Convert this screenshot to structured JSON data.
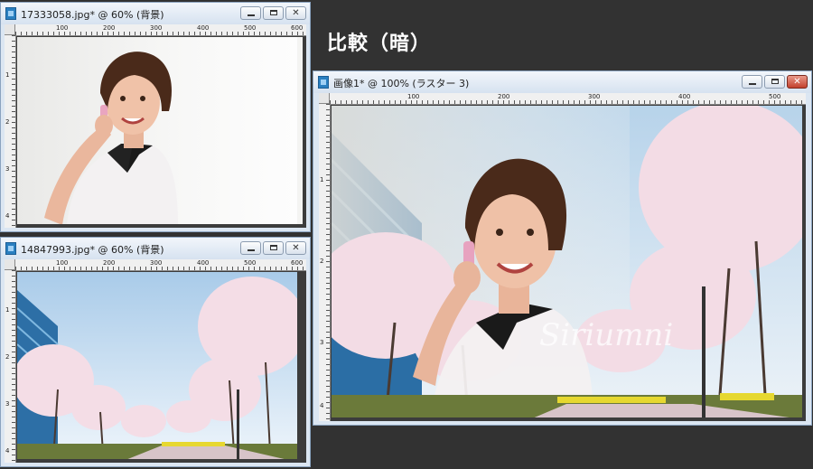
{
  "heading": "比較（暗）",
  "window1": {
    "title": "17333058.jpg* @  60% (背景)",
    "ruler_h": [
      "100",
      "200",
      "300",
      "400",
      "500",
      "600"
    ],
    "ruler_v": [
      "1",
      "2",
      "3",
      "4"
    ]
  },
  "window2": {
    "title": "14847993.jpg* @  60% (背景)",
    "ruler_h": [
      "100",
      "200",
      "300",
      "400",
      "500",
      "600"
    ],
    "ruler_v": [
      "1",
      "2",
      "3",
      "4"
    ]
  },
  "window3": {
    "title": "画像1* @ 100% (ラスター 3)",
    "ruler_h": [
      "100",
      "200",
      "300",
      "400",
      "500"
    ],
    "ruler_v": [
      "1",
      "2",
      "3",
      "4"
    ]
  },
  "buttons": {
    "minimize": "",
    "maximize": "",
    "close": "✕"
  },
  "watermark": "Siriumni"
}
